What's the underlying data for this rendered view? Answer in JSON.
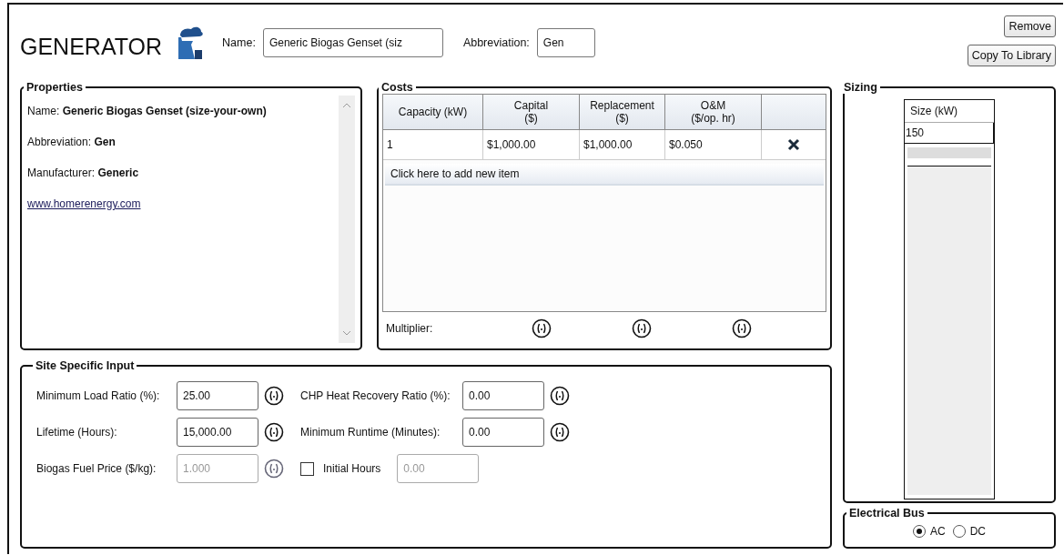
{
  "header": {
    "title": "GENERATOR",
    "name_label": "Name:",
    "name_value": "Generic Biogas Genset (siz",
    "abbr_label": "Abbreviation:",
    "abbr_value": "Gen",
    "buttons": [
      "Remove",
      "Copy To Library"
    ]
  },
  "properties": {
    "title": "Properties",
    "lines": [
      {
        "kind": "text",
        "text": "Name: **Generic Biogas Genset (size-your-own)**"
      },
      {
        "kind": "text",
        "text": "Abbreviation: **Gen**"
      },
      {
        "kind": "text",
        "text": "Manufacturer: **Generic**"
      },
      {
        "kind": "link",
        "text": "www.homerenergy.com"
      }
    ]
  },
  "costs": {
    "title": "Costs",
    "columns": [
      "Capacity (kW)",
      "Capital\n($)",
      "Replacement\n($)",
      "O&M\n($/op. hr)"
    ],
    "rows": [
      {
        "cells": [
          "1",
          "$1,000.00",
          "$1,000.00",
          "$0.050"
        ]
      }
    ],
    "add_item": "Click here to add new item",
    "multiplier_label": "Multiplier:"
  },
  "site_input": {
    "title": "Site Specific Input",
    "fields": [
      {
        "label": "Minimum Load Ratio (%):",
        "value": "25.00",
        "disabled": false
      },
      {
        "label": "CHP Heat Recovery Ratio (%):",
        "value": "0.00",
        "disabled": false
      },
      {
        "label": "Lifetime (Hours):",
        "value": "15,000.00",
        "disabled": false
      },
      {
        "label": "Minimum Runtime (Minutes):",
        "value": "0.00",
        "disabled": false
      },
      {
        "label": "Biogas Fuel Price ($/kg):",
        "value": "1.000",
        "disabled": true
      }
    ],
    "initial_hours": {
      "label": "Initial Hours",
      "checked": false,
      "value": "0.00",
      "disabled": true
    }
  },
  "sizing": {
    "title": "Sizing",
    "column": "Size (kW)",
    "values": [
      "150"
    ]
  },
  "electrical_bus": {
    "title": "Electrical Bus",
    "options": [
      {
        "label": "AC",
        "selected": true
      },
      {
        "label": "DC",
        "selected": false
      }
    ]
  }
}
